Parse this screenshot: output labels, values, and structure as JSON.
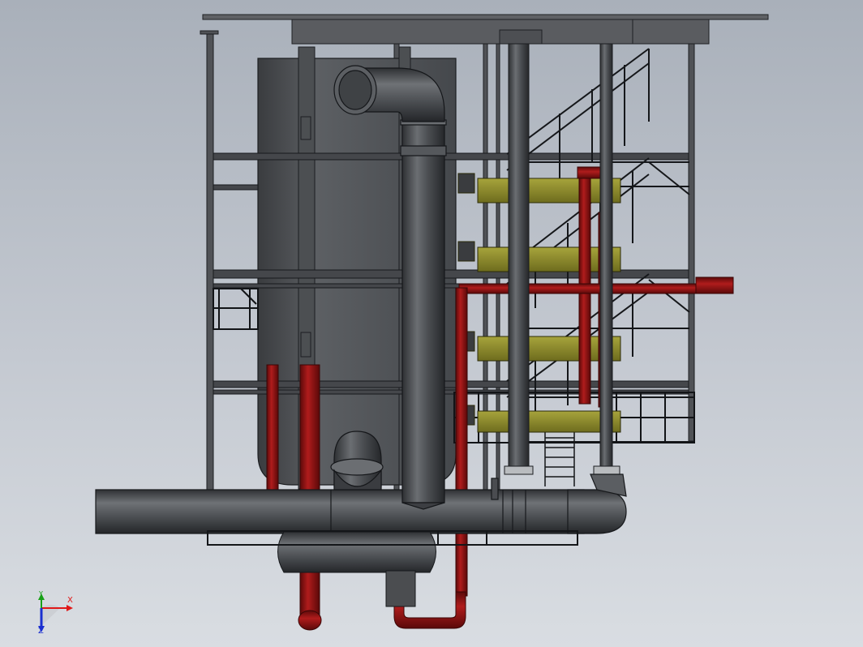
{
  "viewport": {
    "background_top": "#a9b0ba",
    "background_bottom": "#d9dde2"
  },
  "model": {
    "colors": {
      "steel": "#4a4c4f",
      "frame": "#2b2d30",
      "vessel": "#54575b",
      "hot_pipe": "#8e1414",
      "heater": "#8c8a2a",
      "floor": "#6f7174"
    }
  },
  "triad": {
    "x_label": "X",
    "y_label": "Y",
    "z_label": "Z",
    "x_color": "#e01818",
    "y_color": "#18a018",
    "z_color": "#1a2fd0"
  }
}
